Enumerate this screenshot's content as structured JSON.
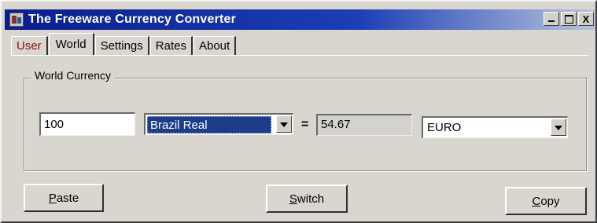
{
  "window": {
    "title": "The Freeware Currency Converter"
  },
  "title_buttons": {
    "minimize": "_",
    "maximize": "□",
    "close": "X"
  },
  "tabs": [
    {
      "label": "User",
      "active": false
    },
    {
      "label": "World",
      "active": true
    },
    {
      "label": "Settings",
      "active": false
    },
    {
      "label": "Rates",
      "active": false
    },
    {
      "label": "About",
      "active": false
    }
  ],
  "world": {
    "group_label": "World Currency",
    "amount": "100",
    "from_currency": "Brazil Real",
    "equals": "=",
    "result": "54.67",
    "to_currency": "EURO"
  },
  "buttons": {
    "paste": {
      "mnemonic": "P",
      "rest": "aste"
    },
    "switch": {
      "mnemonic": "S",
      "rest": "witch"
    },
    "copy": {
      "mnemonic": "C",
      "rest": "opy"
    }
  },
  "colors": {
    "title_bar_start": "#0a1e8c",
    "title_bar_end": "#b9c4dd",
    "selection": "#1e3c8a",
    "user_tab_text": "#8a1010"
  }
}
